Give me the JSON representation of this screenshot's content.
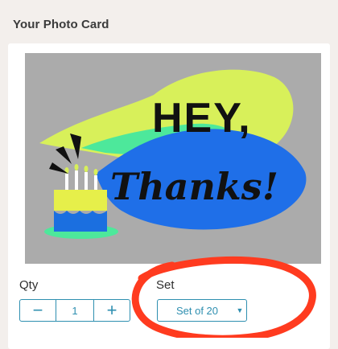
{
  "header": {
    "title": "Your Photo Card"
  },
  "card": {
    "greeting_line1": "HEY,",
    "greeting_line2": "Thanks!",
    "colors": {
      "background": "#a9a9a9",
      "bubble_yellow": "#d8f05a",
      "bubble_green": "#4de89b",
      "bubble_blue": "#1f6fe8",
      "cake_yellow": "#e6ef4a",
      "cake_blue": "#1b6fe0",
      "ink": "#111111"
    }
  },
  "options": {
    "qty_label": "Qty",
    "qty_value": "1",
    "minus_symbol": "−",
    "plus_symbol": "+",
    "set_label": "Set",
    "set_value": "Set of 20",
    "caret": "▼"
  },
  "colors": {
    "accent": "#2e8fb0",
    "annotation": "#ff3b1f"
  }
}
